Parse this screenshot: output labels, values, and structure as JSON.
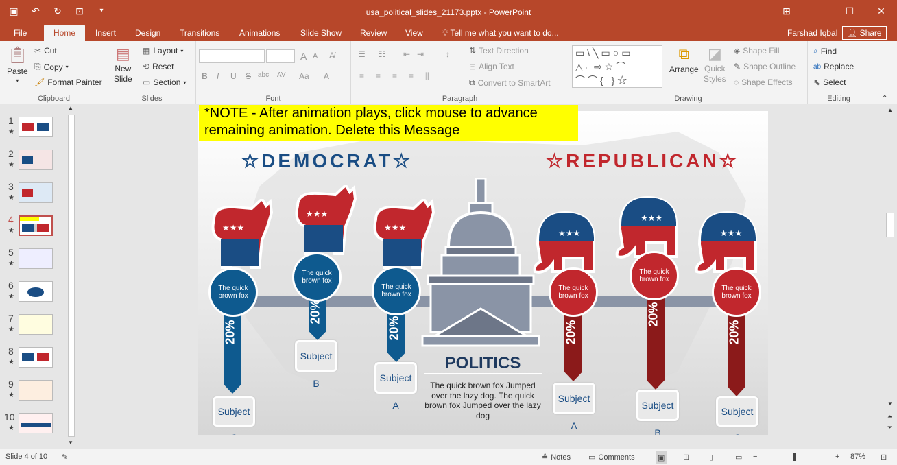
{
  "titlebar": {
    "doc_title": "usa_political_slides_21173.pptx - PowerPoint",
    "user": "Farshad Iqbal",
    "share": "Share"
  },
  "tabs": [
    "File",
    "Home",
    "Insert",
    "Design",
    "Transitions",
    "Animations",
    "Slide Show",
    "Review",
    "View"
  ],
  "tell_me": "Tell me what you want to do...",
  "clipboard": {
    "paste": "Paste",
    "cut": "Cut",
    "copy": "Copy",
    "format_painter": "Format Painter",
    "label": "Clipboard"
  },
  "slides_group": {
    "new_slide_1": "New",
    "new_slide_2": "Slide",
    "layout": "Layout",
    "reset": "Reset",
    "section": "Section",
    "label": "Slides"
  },
  "font_group": {
    "label": "Font",
    "bold": "B",
    "italic": "I",
    "underline": "U",
    "strike": "S",
    "shadow": "abc",
    "spacing": "AV",
    "case": "Aa"
  },
  "paragraph_group": {
    "text_direction": "Text Direction",
    "align_text": "Align Text",
    "convert_smartart": "Convert to SmartArt",
    "label": "Paragraph"
  },
  "drawing_group": {
    "arrange": "Arrange",
    "quick_styles_1": "Quick",
    "quick_styles_2": "Styles",
    "shape_fill": "Shape Fill",
    "shape_outline": "Shape Outline",
    "shape_effects": "Shape Effects",
    "label": "Drawing"
  },
  "editing_group": {
    "find": "Find",
    "replace": "Replace",
    "select": "Select",
    "label": "Editing"
  },
  "thumbnails": [
    "1",
    "2",
    "3",
    "4",
    "5",
    "6",
    "7",
    "8",
    "9",
    "10"
  ],
  "slide": {
    "note": "*NOTE - After animation plays, click mouse to advance remaining animation. Delete this Message",
    "democrat": "☆DEMOCRAT☆",
    "republican": "☆REPUBLICAN☆",
    "politics": "POLITICS",
    "politics_body": "The quick brown fox Jumped over the lazy dog. The quick brown fox Jumped over the lazy dog",
    "circle_text": "The quick brown fox",
    "percent": "20%",
    "stars": "★★★",
    "subjects_dem": [
      "Subject C",
      "Subject B",
      "Subject A"
    ],
    "subjects_rep": [
      "Subject A",
      "Subject B",
      "Subject C"
    ]
  },
  "status": {
    "slide_of": "Slide 4 of 10",
    "notes": "Notes",
    "comments": "Comments",
    "zoom": "87%"
  },
  "colors": {
    "accent": "#b7472a",
    "democrat": "#1a4d84",
    "republican": "#c1272d",
    "note": "#ffff00"
  }
}
